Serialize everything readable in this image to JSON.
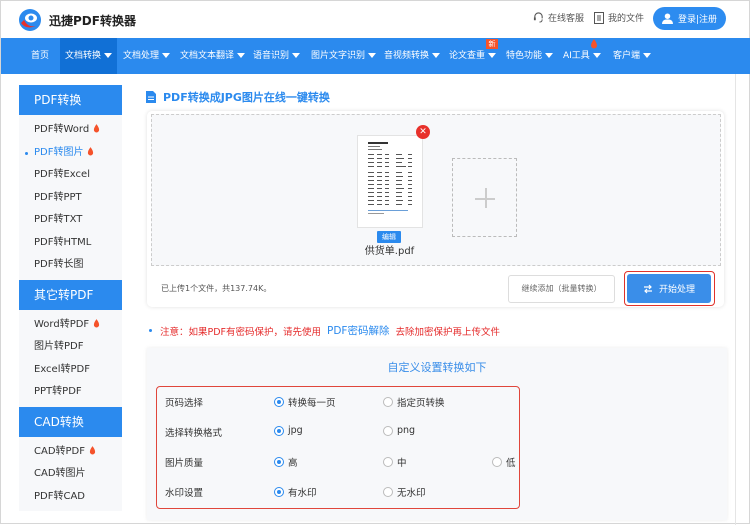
{
  "header": {
    "brand": "迅捷PDF转换器",
    "service_label": "在线客服",
    "files_label": "我的文件",
    "login_label": "登录|注册"
  },
  "nav": {
    "items": [
      {
        "label": "首页",
        "dropdown": false
      },
      {
        "label": "文档转换",
        "dropdown": true,
        "active": true
      },
      {
        "label": "文档处理",
        "dropdown": true
      },
      {
        "label": "文档文本翻译",
        "dropdown": true
      },
      {
        "label": "语音识别",
        "dropdown": true
      },
      {
        "label": "图片文字识别",
        "dropdown": true
      },
      {
        "label": "音视频转换",
        "dropdown": true
      },
      {
        "label": "论文查重",
        "dropdown": true,
        "badge": "新"
      },
      {
        "label": "特色功能",
        "dropdown": true
      },
      {
        "label": "AI工具",
        "dropdown": true,
        "flame": true
      },
      {
        "label": "客户端",
        "dropdown": true
      }
    ]
  },
  "sidebar": {
    "groups": [
      {
        "title": "PDF转换",
        "items": [
          {
            "label": "PDF转Word",
            "hot": true
          },
          {
            "label": "PDF转图片",
            "hot": true,
            "active": true
          },
          {
            "label": "PDF转Excel"
          },
          {
            "label": "PDF转PPT"
          },
          {
            "label": "PDF转TXT"
          },
          {
            "label": "PDF转HTML"
          },
          {
            "label": "PDF转长图"
          }
        ]
      },
      {
        "title": "其它转PDF",
        "items": [
          {
            "label": "Word转PDF",
            "hot": true
          },
          {
            "label": "图片转PDF"
          },
          {
            "label": "Excel转PDF"
          },
          {
            "label": "PPT转PDF"
          }
        ]
      },
      {
        "title": "CAD转换",
        "items": [
          {
            "label": "CAD转PDF",
            "hot": true
          },
          {
            "label": "CAD转图片"
          },
          {
            "label": "PDF转CAD"
          }
        ]
      }
    ]
  },
  "main": {
    "title": "PDF转换成JPG图片在线一键转换",
    "file": {
      "name": "供货单.pdf",
      "edit_label": "编辑"
    },
    "upload_info": "已上传1个文件，共137.74K。",
    "continue_label": "继续添加（批量转换）",
    "start_label": "开始处理",
    "notice": {
      "before": "注意：如果PDF有密码保护，请先使用",
      "link": "PDF密码解除",
      "after": "去除加密保护再上传文件"
    }
  },
  "settings": {
    "title": "自定义设置转换如下",
    "rows": [
      {
        "label": "页码选择",
        "options": [
          {
            "label": "转换每一页",
            "selected": true
          },
          {
            "label": "指定页转换",
            "selected": false
          }
        ]
      },
      {
        "label": "选择转换格式",
        "options": [
          {
            "label": "jpg",
            "selected": true
          },
          {
            "label": "png",
            "selected": false
          }
        ]
      },
      {
        "label": "图片质量",
        "options": [
          {
            "label": "高",
            "selected": true
          },
          {
            "label": "中",
            "selected": false
          },
          {
            "label": "低",
            "selected": false
          }
        ]
      },
      {
        "label": "水印设置",
        "options": [
          {
            "label": "有水印",
            "selected": true
          },
          {
            "label": "无水印",
            "selected": false
          }
        ]
      }
    ]
  },
  "colors": {
    "primary": "#2b8aee",
    "nav_active": "#1170d6",
    "alert": "#e52b2b",
    "hot": "#f5532b"
  }
}
